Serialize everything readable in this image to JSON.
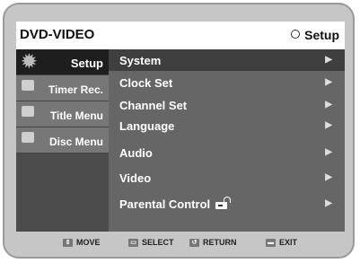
{
  "header": {
    "title": "DVD-VIDEO",
    "section": "Setup"
  },
  "sidebar": {
    "items": [
      {
        "label": "Setup"
      },
      {
        "label": "Timer Rec."
      },
      {
        "label": "Title Menu"
      },
      {
        "label": "Disc Menu"
      }
    ]
  },
  "menu": {
    "items": [
      {
        "label": "System",
        "arrow": "▶"
      },
      {
        "label": "Clock Set",
        "arrow": "▶"
      },
      {
        "label": "Channel Set",
        "arrow": "▶"
      },
      {
        "label": "Language",
        "arrow": "▶"
      },
      {
        "label": "Audio",
        "arrow": "▶"
      },
      {
        "label": "Video",
        "arrow": "▶"
      },
      {
        "label": "Parental Control",
        "arrow": "▶"
      }
    ]
  },
  "footer": {
    "move": "MOVE",
    "select": "SELECT",
    "return": "RETURN",
    "exit": "EXIT"
  }
}
